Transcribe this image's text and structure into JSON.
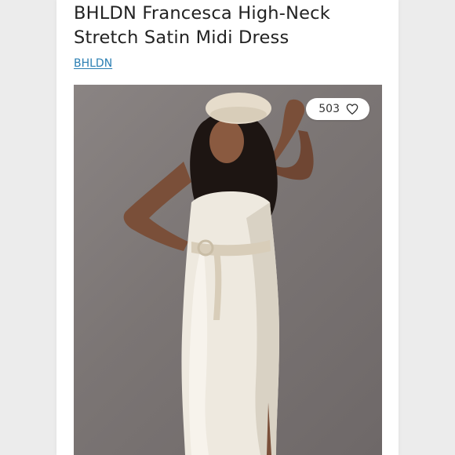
{
  "listing": {
    "title": "BHLDN Francesca High-Neck Stretch Satin Midi Dress",
    "brand": "BHLDN"
  },
  "photo": {
    "like_count": "503",
    "like_icon": "heart-icon"
  },
  "colors": {
    "brand_link": "#2b7fb3",
    "title_text": "#222222",
    "photo_background": "#7b7574"
  }
}
